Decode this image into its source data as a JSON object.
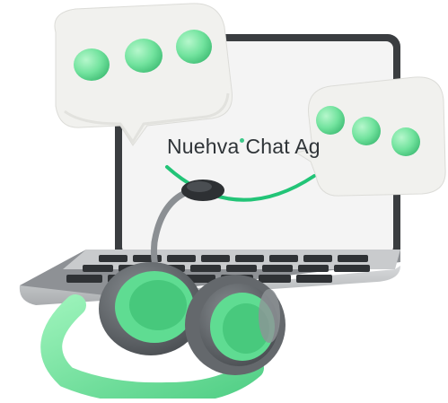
{
  "illustration": {
    "screen_text": {
      "part1": "Nuehva",
      "part2": "Chat Ag"
    },
    "icons": [
      "laptop-icon",
      "headset-icon",
      "chat-bubble-icon",
      "smile-icon"
    ],
    "colors": {
      "accent": "#3ec98a",
      "accent_light": "#8ff0b4",
      "bubble": "#f1f1ee",
      "laptop_frame": "#3a3d40",
      "screen": "#f4f4f4",
      "headset_dark": "#5b5f63"
    }
  }
}
